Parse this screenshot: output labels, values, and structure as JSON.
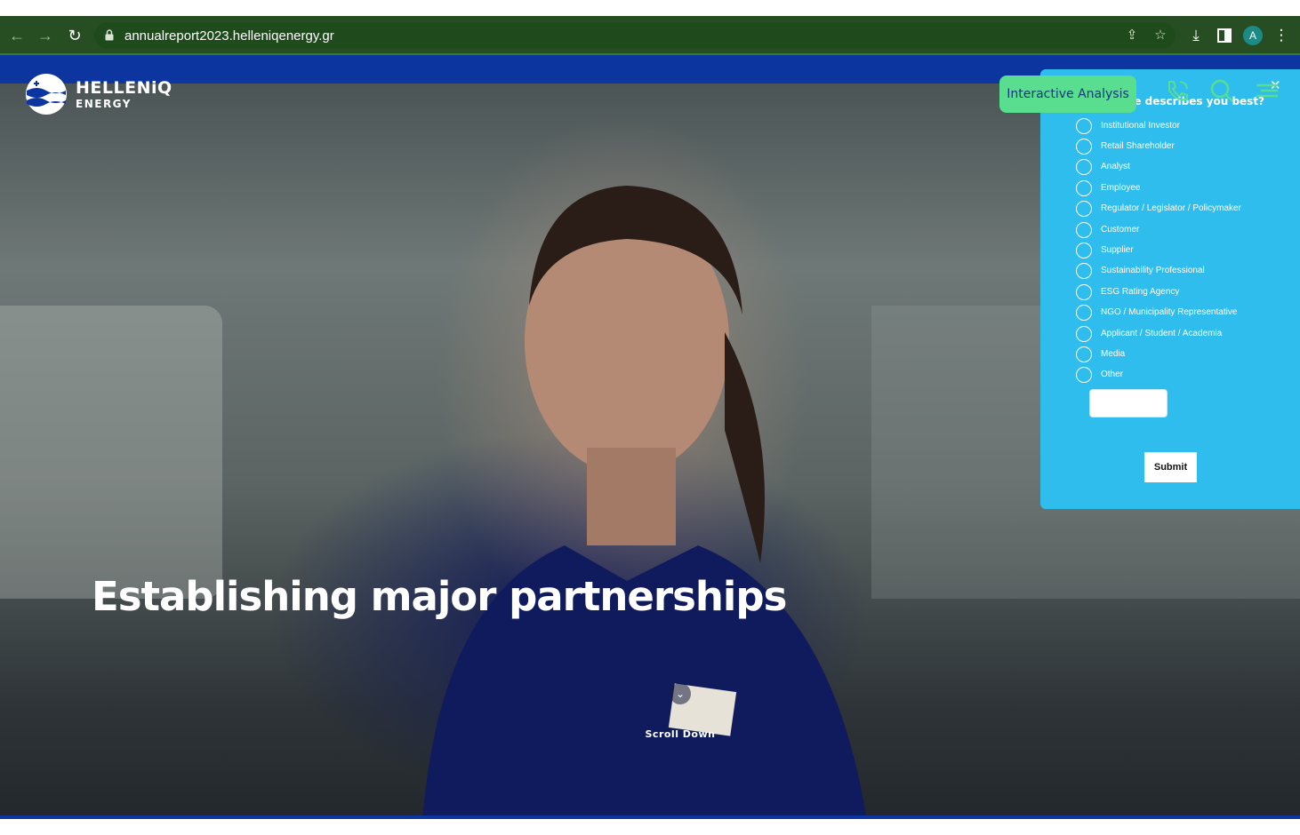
{
  "browser": {
    "url": "annualreport2023.helleniqenergy.gr",
    "profile_initial": "A",
    "icons": [
      "back-arrow-icon",
      "forward-arrow-icon",
      "reload-icon",
      "lock-icon",
      "share-icon",
      "star-icon",
      "download-icon",
      "side-panel-icon",
      "profile-avatar",
      "kebab-menu-icon"
    ]
  },
  "header": {
    "logo_name": "HELLENiQ",
    "logo_sub": "ENERGY",
    "interactive_analysis_label": "Interactive Analysis",
    "icons": [
      "phone-icon",
      "search-icon",
      "menu-icon"
    ]
  },
  "hero": {
    "headline": "Establishing major partnerships",
    "scroll_label": "Scroll Down"
  },
  "survey": {
    "question": "ese describes you best?",
    "options": [
      "Institutional Investor",
      "Retail Shareholder",
      "Analyst",
      "Employee",
      "Regulator / Legislator / Policymaker",
      "Customer",
      "Supplier",
      "Sustainability Professional",
      "ESG Rating Agency",
      "NGO / Municipality Representative",
      "Applicant / Student / Academia",
      "Media",
      "Other"
    ],
    "other_input_value": "",
    "submit_label": "Submit"
  },
  "colors": {
    "browser_bar": "#274d23",
    "brand_blue": "#0c35a0",
    "survey_bg": "#2fbdee",
    "analysis_green": "#58de8e"
  }
}
